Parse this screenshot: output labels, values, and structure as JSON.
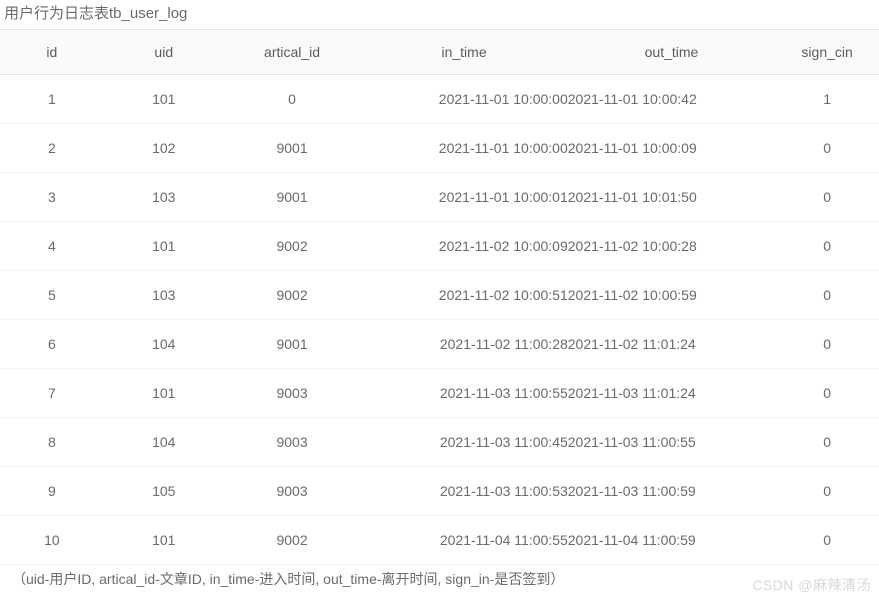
{
  "title": "用户行为日志表tb_user_log",
  "columns": {
    "id": "id",
    "uid": "uid",
    "artical_id": "artical_id",
    "in_time": "in_time",
    "out_time": "out_time",
    "sign_cin": "sign_cin"
  },
  "rows": [
    {
      "id": "1",
      "uid": "101",
      "artical_id": "0",
      "in_time": "2021-11-01 10:00:00",
      "out_time": "2021-11-01 10:00:42",
      "sign_cin": "1"
    },
    {
      "id": "2",
      "uid": "102",
      "artical_id": "9001",
      "in_time": "2021-11-01 10:00:00",
      "out_time": "2021-11-01 10:00:09",
      "sign_cin": "0"
    },
    {
      "id": "3",
      "uid": "103",
      "artical_id": "9001",
      "in_time": "2021-11-01 10:00:01",
      "out_time": "2021-11-01 10:01:50",
      "sign_cin": "0"
    },
    {
      "id": "4",
      "uid": "101",
      "artical_id": "9002",
      "in_time": "2021-11-02 10:00:09",
      "out_time": "2021-11-02 10:00:28",
      "sign_cin": "0"
    },
    {
      "id": "5",
      "uid": "103",
      "artical_id": "9002",
      "in_time": "2021-11-02 10:00:51",
      "out_time": "2021-11-02 10:00:59",
      "sign_cin": "0"
    },
    {
      "id": "6",
      "uid": "104",
      "artical_id": "9001",
      "in_time": "2021-11-02 11:00:28",
      "out_time": "2021-11-02 11:01:24",
      "sign_cin": "0"
    },
    {
      "id": "7",
      "uid": "101",
      "artical_id": "9003",
      "in_time": "2021-11-03 11:00:55",
      "out_time": "2021-11-03 11:01:24",
      "sign_cin": "0"
    },
    {
      "id": "8",
      "uid": "104",
      "artical_id": "9003",
      "in_time": "2021-11-03 11:00:45",
      "out_time": "2021-11-03 11:00:55",
      "sign_cin": "0"
    },
    {
      "id": "9",
      "uid": "105",
      "artical_id": "9003",
      "in_time": "2021-11-03 11:00:53",
      "out_time": "2021-11-03 11:00:59",
      "sign_cin": "0"
    },
    {
      "id": "10",
      "uid": "101",
      "artical_id": "9002",
      "in_time": "2021-11-04 11:00:55",
      "out_time": "2021-11-04 11:00:59",
      "sign_cin": "0"
    }
  ],
  "footer": "（uid-用户ID, artical_id-文章ID, in_time-进入时间, out_time-离开时间, sign_in-是否签到）",
  "watermark": "CSDN @麻辣清汤"
}
